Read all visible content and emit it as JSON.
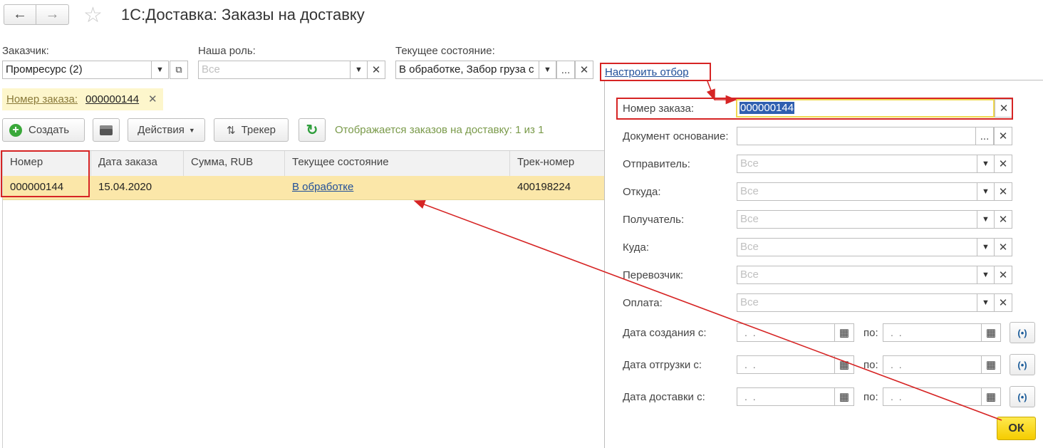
{
  "window": {
    "title": "1С:Доставка: Заказы на доставку"
  },
  "filters": {
    "customer_label": "Заказчик:",
    "customer_value": "Промресурс (2)",
    "role_label": "Наша роль:",
    "role_placeholder": "Все",
    "state_label": "Текущее состояние:",
    "state_value": "В обработке, Забор груза с"
  },
  "active_filter": {
    "label": "Номер заказа:",
    "value": "000000144"
  },
  "toolbar": {
    "create_label": "Создать",
    "actions_label": "Действия",
    "tracker_label": "Трекер",
    "status_text": "Отображается заказов на доставку: 1 из 1"
  },
  "table": {
    "columns": [
      "Номер",
      "Дата заказа",
      "Сумма, RUB",
      "Текущее состояние",
      "Трек-номер"
    ],
    "rows": [
      {
        "number": "000000144",
        "date": "15.04.2020",
        "sum": "",
        "state": "В обработке",
        "track": "400198224"
      }
    ]
  },
  "filter_panel": {
    "link": "Настроить отбор",
    "fields": [
      {
        "label": "Номер заказа:",
        "value": "000000144"
      },
      {
        "label": "Документ основание:",
        "value": ""
      },
      {
        "label": "Отправитель:",
        "placeholder": "Все"
      },
      {
        "label": "Откуда:",
        "placeholder": "Все"
      },
      {
        "label": "Получатель:",
        "placeholder": "Все"
      },
      {
        "label": "Куда:",
        "placeholder": "Все"
      },
      {
        "label": "Перевозчик:",
        "placeholder": "Все"
      },
      {
        "label": "Оплата:",
        "placeholder": "Все"
      }
    ],
    "dates": [
      {
        "label": "Дата создания с:",
        "to": "по:",
        "from_value": ". .",
        "to_value": ". ."
      },
      {
        "label": "Дата отгрузки с:",
        "to": "по:",
        "from_value": ". .",
        "to_value": ". ."
      },
      {
        "label": "Дата доставки с:",
        "to": "по:",
        "from_value": ". .",
        "to_value": ". ."
      }
    ],
    "ok_label": "ОК"
  },
  "colors": {
    "accent_yellow": "#ffd500",
    "highlight_row": "#fbe7a9",
    "annotation_red": "#d62424",
    "link_blue": "#1f4e99"
  }
}
